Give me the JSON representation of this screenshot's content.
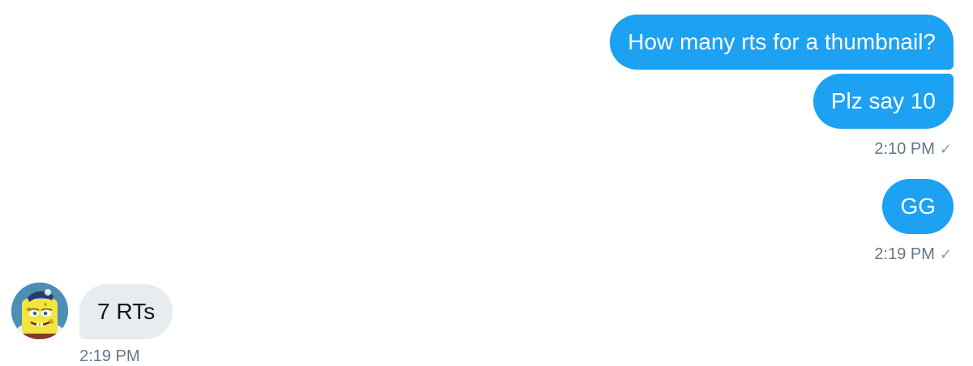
{
  "conversation": {
    "messages": [
      {
        "direction": "outgoing",
        "text": "How many rts for a thumbnail?"
      },
      {
        "direction": "outgoing",
        "text": "Plz say 10"
      },
      {
        "direction": "outgoing",
        "text": "GG"
      },
      {
        "direction": "incoming",
        "text": "7 RTs"
      }
    ],
    "timestamps": [
      {
        "time": "2:10 PM",
        "status_icon": "check-icon"
      },
      {
        "time": "2:19 PM",
        "status_icon": "check-icon"
      },
      {
        "time": "2:19 PM"
      }
    ],
    "check_glyph": "✓"
  },
  "colors": {
    "outgoing_bubble": "#1da1f2",
    "incoming_bubble": "#e6ecf0",
    "timestamp": "#657786"
  }
}
